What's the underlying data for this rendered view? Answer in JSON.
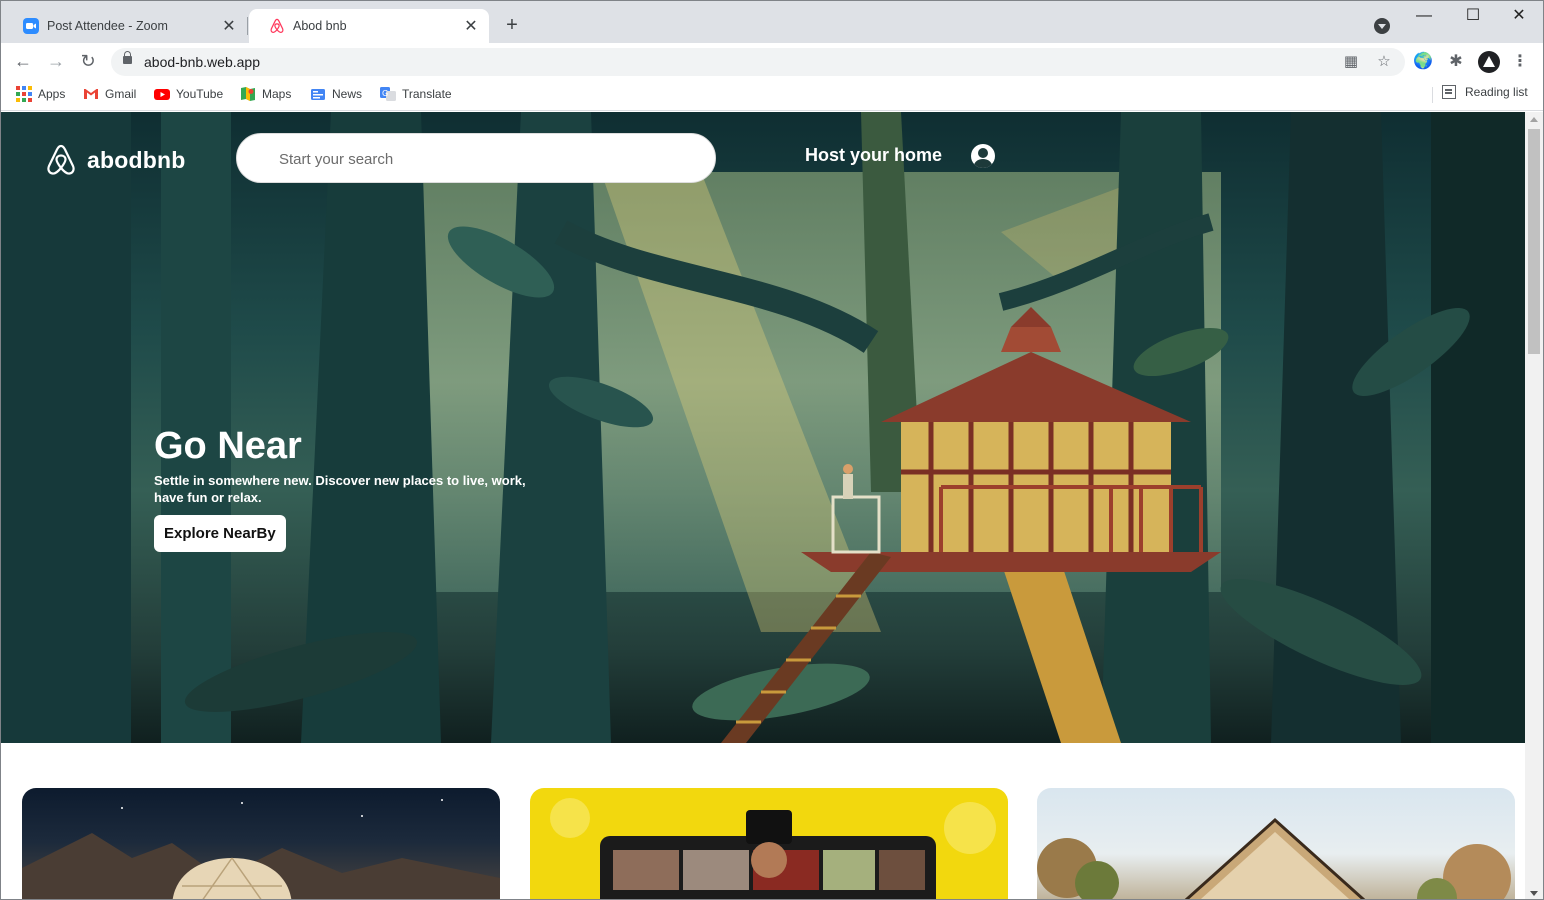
{
  "browser": {
    "tabs": [
      {
        "title": "Post Attendee - Zoom",
        "icon": "zoom-icon",
        "active": false
      },
      {
        "title": "Abod bnb",
        "icon": "airbnb-logo-icon",
        "active": true
      }
    ],
    "url": "abod-bnb.web.app",
    "bookmarks": [
      {
        "label": "Apps",
        "icon": "apps-grid-icon"
      },
      {
        "label": "Gmail",
        "icon": "gmail-icon"
      },
      {
        "label": "YouTube",
        "icon": "youtube-icon"
      },
      {
        "label": "Maps",
        "icon": "maps-icon"
      },
      {
        "label": "News",
        "icon": "news-icon"
      },
      {
        "label": "Translate",
        "icon": "translate-icon"
      }
    ],
    "reading_list": "Reading list"
  },
  "page": {
    "brand": "abodbnb",
    "search_placeholder": "Start your search",
    "host_link": "Host your home",
    "hero": {
      "title": "Go Near",
      "subtitle": "Settle in somewhere new. Discover new places to live, work, have fun or relax.",
      "cta": "Explore NearBy"
    },
    "cards": [
      {
        "icon": "glamping-dome-image"
      },
      {
        "icon": "online-experiences-image"
      },
      {
        "icon": "cabin-house-image"
      }
    ]
  },
  "colors": {
    "brand_red": "#ff385c",
    "hero_teal": "#1f4b4a",
    "card_yellow": "#f2d80e"
  }
}
